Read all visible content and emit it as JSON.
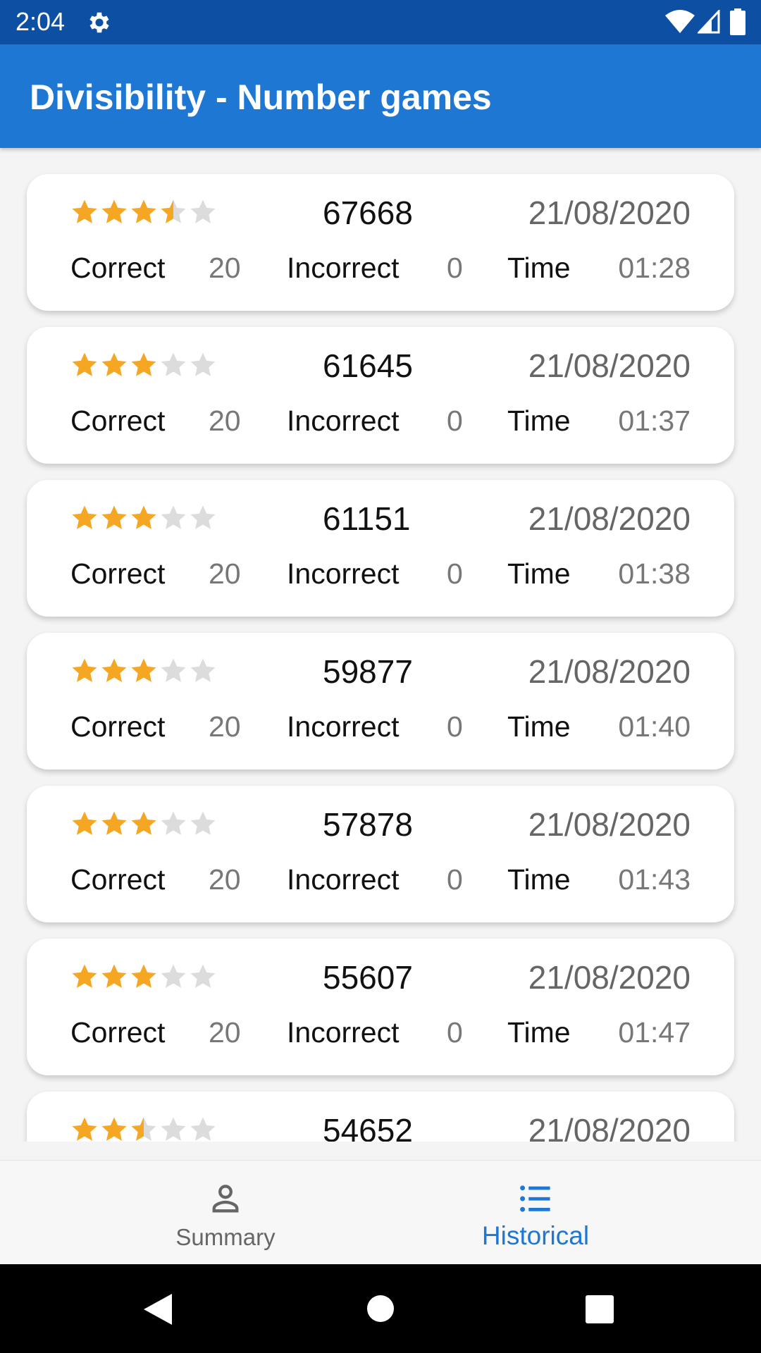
{
  "status_bar": {
    "time": "2:04"
  },
  "app_bar": {
    "title": "Divisibility - Number games"
  },
  "labels": {
    "correct": "Correct",
    "incorrect": "Incorrect",
    "time": "Time"
  },
  "colors": {
    "primary": "#1e77d3",
    "status_bar": "#0d4fa3",
    "star_filled": "#f5a623",
    "star_empty": "#dcdcdc"
  },
  "games": [
    {
      "rating": 3.5,
      "code": "67668",
      "date": "21/08/2020",
      "correct": "20",
      "incorrect": "0",
      "time": "01:28"
    },
    {
      "rating": 3,
      "code": "61645",
      "date": "21/08/2020",
      "correct": "20",
      "incorrect": "0",
      "time": "01:37"
    },
    {
      "rating": 3,
      "code": "61151",
      "date": "21/08/2020",
      "correct": "20",
      "incorrect": "0",
      "time": "01:38"
    },
    {
      "rating": 3,
      "code": "59877",
      "date": "21/08/2020",
      "correct": "20",
      "incorrect": "0",
      "time": "01:40"
    },
    {
      "rating": 3,
      "code": "57878",
      "date": "21/08/2020",
      "correct": "20",
      "incorrect": "0",
      "time": "01:43"
    },
    {
      "rating": 3,
      "code": "55607",
      "date": "21/08/2020",
      "correct": "20",
      "incorrect": "0",
      "time": "01:47"
    },
    {
      "rating": 2.5,
      "code": "54652",
      "date": "21/08/2020",
      "correct": "",
      "incorrect": "",
      "time": ""
    }
  ],
  "bottom_nav": {
    "items": [
      {
        "label": "Summary",
        "icon": "person-icon",
        "selected": false
      },
      {
        "label": "Historical",
        "icon": "list-icon",
        "selected": true
      }
    ]
  },
  "system_nav": {
    "back_icon": "back-triangle-icon",
    "home_icon": "home-circle-icon",
    "recent_icon": "recent-square-icon"
  }
}
